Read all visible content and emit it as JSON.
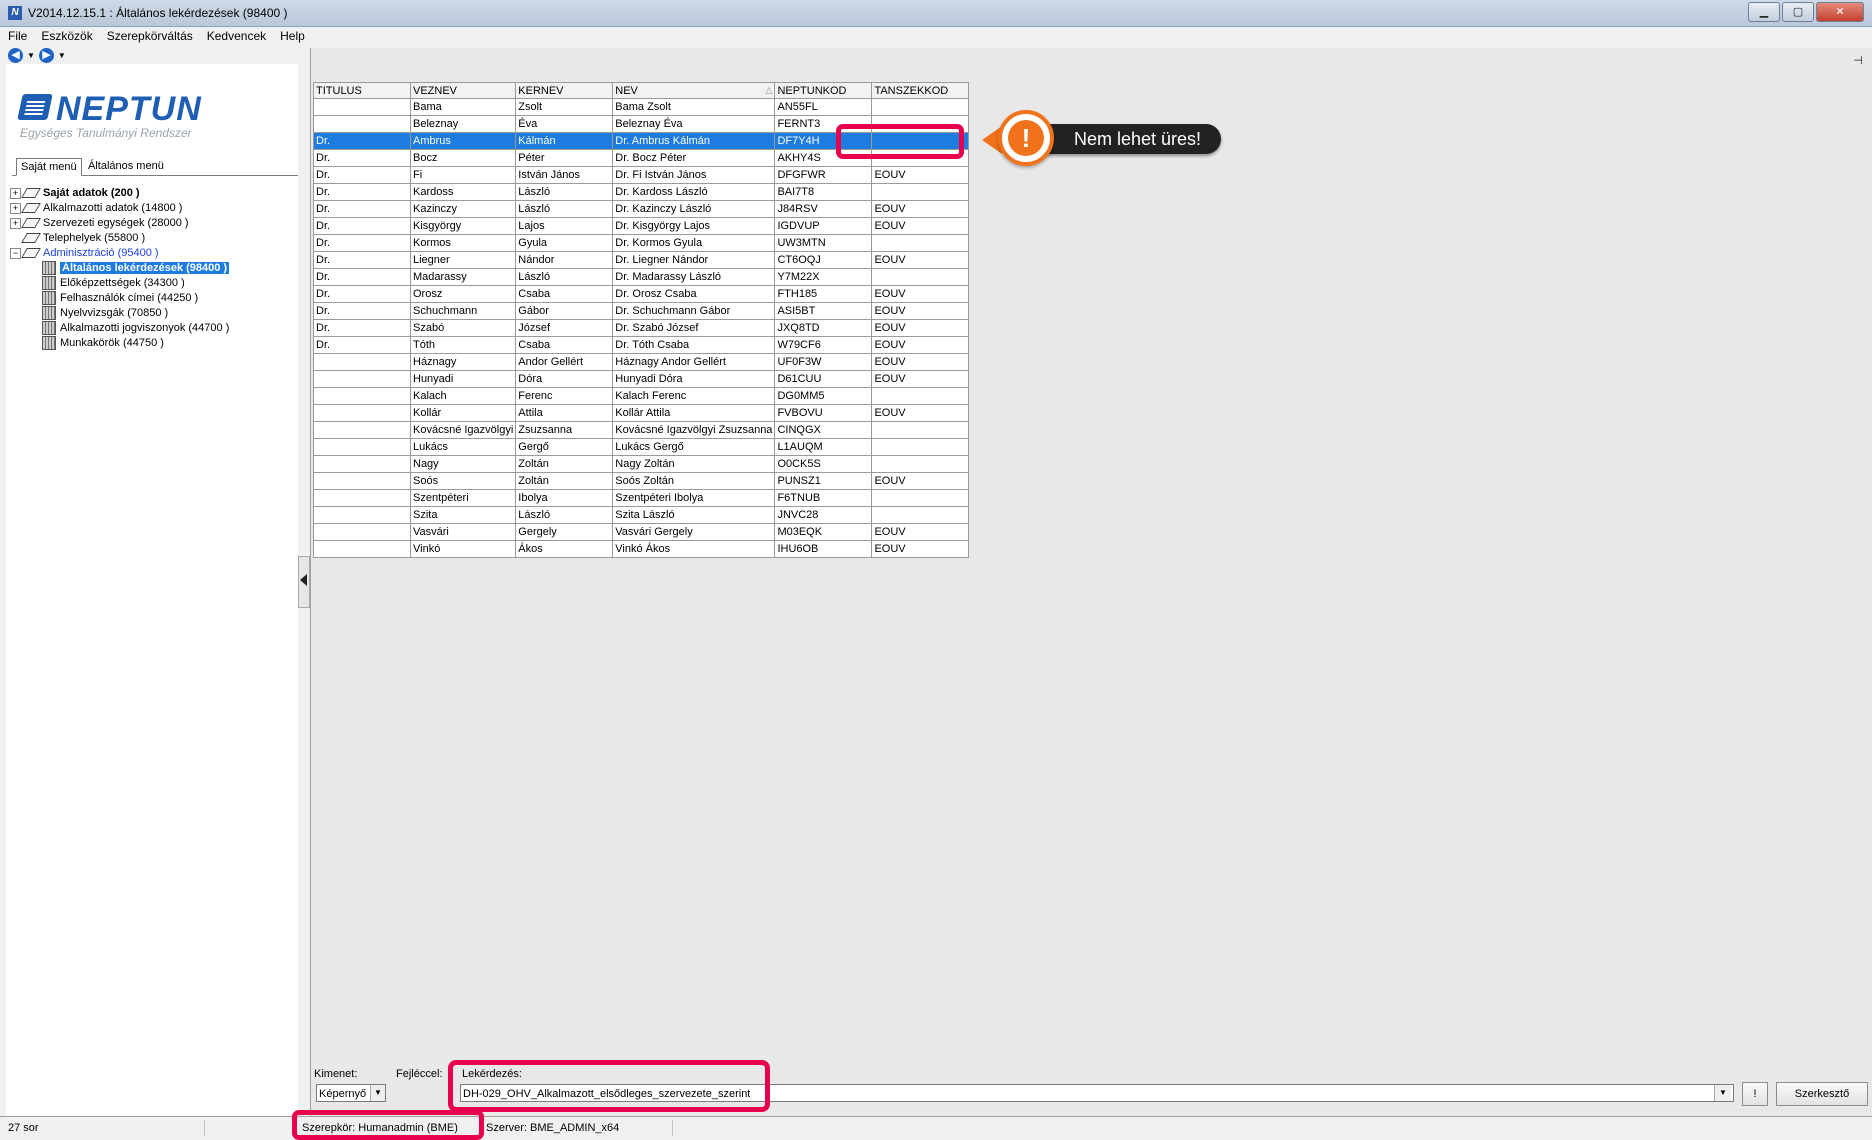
{
  "window": {
    "title": "V2014.12.15.1 : Általános lekérdezések (98400 )"
  },
  "menu": [
    "File",
    "Eszközök",
    "Szerepkörváltás",
    "Kedvencek",
    "Help"
  ],
  "logo": {
    "name": "NEPTUN",
    "subtitle": "Egységes Tanulmányi Rendszer"
  },
  "left_tabs": {
    "active": "Saját menü",
    "inactive": "Általános menü"
  },
  "tree": {
    "items": [
      {
        "label": "Saját adatok (200 )",
        "expander": "+"
      },
      {
        "label": "Alkalmazotti adatok (14800 )",
        "expander": "+"
      },
      {
        "label": "Szervezeti egységek (28000 )",
        "expander": "+"
      },
      {
        "label": "Telephelyek (55800 )",
        "expander": ""
      },
      {
        "label": "Adminisztráció (95400 )",
        "expander": "−"
      },
      {
        "label": "Általános lekérdezések (98400 )"
      },
      {
        "label": "Előképzettségek (34300 )"
      },
      {
        "label": "Felhasználók címei (44250 )"
      },
      {
        "label": "Nyelvvizsgák (70850 )"
      },
      {
        "label": "Alkalmazotti jogviszonyok (44700 )"
      },
      {
        "label": "Munkakörök (44750 )"
      }
    ]
  },
  "grid": {
    "columns": [
      "TITULUS",
      "VEZNEV",
      "KERNEV",
      "NEV",
      "NEPTUNKOD",
      "TANSZEKKOD"
    ],
    "sort_indicator": "△",
    "rows": [
      [
        "",
        "Bama",
        "Zsolt",
        "Bama Zsolt",
        "AN55FL",
        ""
      ],
      [
        "",
        "Beleznay",
        "Éva",
        "Beleznay Éva",
        "FERNT3",
        ""
      ],
      [
        "Dr.",
        "Ambrus",
        "Kálmán",
        "Dr. Ambrus Kálmán",
        "DF7Y4H",
        ""
      ],
      [
        "Dr.",
        "Bocz",
        "Péter",
        "Dr. Bocz Péter",
        "AKHY4S",
        ""
      ],
      [
        "Dr.",
        "Fi",
        "István János",
        "Dr. Fi István János",
        "DFGFWR",
        "EOUV"
      ],
      [
        "Dr.",
        "Kardoss",
        "László",
        "Dr. Kardoss László",
        "BAI7T8",
        ""
      ],
      [
        "Dr.",
        "Kazinczy",
        "László",
        "Dr. Kazinczy László",
        "J84RSV",
        "EOUV"
      ],
      [
        "Dr.",
        "Kisgyörgy",
        "Lajos",
        "Dr. Kisgyörgy Lajos",
        "IGDVUP",
        "EOUV"
      ],
      [
        "Dr.",
        "Kormos",
        "Gyula",
        "Dr. Kormos Gyula",
        "UW3MTN",
        ""
      ],
      [
        "Dr.",
        "Liegner",
        "Nándor",
        "Dr. Liegner Nándor",
        "CT6OQJ",
        "EOUV"
      ],
      [
        "Dr.",
        "Madarassy",
        "László",
        "Dr. Madarassy László",
        "Y7M22X",
        ""
      ],
      [
        "Dr.",
        "Orosz",
        "Csaba",
        "Dr. Orosz Csaba",
        "FTH185",
        "EOUV"
      ],
      [
        "Dr.",
        "Schuchmann",
        "Gábor",
        "Dr. Schuchmann Gábor",
        "ASI5BT",
        "EOUV"
      ],
      [
        "Dr.",
        "Szabó",
        "József",
        "Dr. Szabó József",
        "JXQ8TD",
        "EOUV"
      ],
      [
        "Dr.",
        "Tóth",
        "Csaba",
        "Dr. Tóth Csaba",
        "W79CF6",
        "EOUV"
      ],
      [
        "",
        "Háznagy",
        "Andor Gellért",
        "Háznagy Andor Gellért",
        "UF0F3W",
        "EOUV"
      ],
      [
        "",
        "Hunyadi",
        "Dóra",
        "Hunyadi Dóra",
        "D61CUU",
        "EOUV"
      ],
      [
        "",
        "Kalach",
        "Ferenc",
        "Kalach Ferenc",
        "DG0MM5",
        ""
      ],
      [
        "",
        "Kollár",
        "Attila",
        "Kollár Attila",
        "FVBOVU",
        "EOUV"
      ],
      [
        "",
        "Kovácsné Igazvölgyi",
        "Zsuzsanna",
        "Kovácsné Igazvölgyi Zsuzsanna",
        "CINQGX",
        ""
      ],
      [
        "",
        "Lukács",
        "Gergő",
        "Lukács Gergő",
        "L1AUQM",
        ""
      ],
      [
        "",
        "Nagy",
        "Zoltán",
        "Nagy Zoltán",
        "O0CK5S",
        ""
      ],
      [
        "",
        "Soós",
        "Zoltán",
        "Soós Zoltán",
        "PUNSZ1",
        "EOUV"
      ],
      [
        "",
        "Szentpéteri",
        "Ibolya",
        "Szentpéteri Ibolya",
        "F6TNUB",
        ""
      ],
      [
        "",
        "Szita",
        "László",
        "Szita László",
        "JNVC28",
        ""
      ],
      [
        "",
        "Vasvári",
        "Gergely",
        "Vasvári Gergely",
        "M03EQK",
        "EOUV"
      ],
      [
        "",
        "Vinkó",
        "Ákos",
        "Vinkó Ákos",
        "IHU6OB",
        "EOUV"
      ]
    ],
    "selected_row_index": 2
  },
  "callout": {
    "text": "Nem lehet üres!",
    "symbol": "!"
  },
  "bottom": {
    "kimenet_label": "Kimenet:",
    "kimenet_value": "Képernyő",
    "fejleccel_label": "Fejléccel:",
    "query_label": "Lekérdezés:",
    "query_value": "DH-029_OHV_Alkalmazott_elsődleges_szervezete_szerint",
    "exec_label": "!",
    "edit_label": "Szerkesztő"
  },
  "status": {
    "rows": "27 sor",
    "role": "Szerepkör: Humanadmin (BME)",
    "server": "Szerver: BME_ADMIN_x64"
  },
  "colors": {
    "selection": "#1e7be0",
    "highlight": "#e8004f",
    "callout": "#f0731b",
    "brand": "#1e5fb3"
  }
}
